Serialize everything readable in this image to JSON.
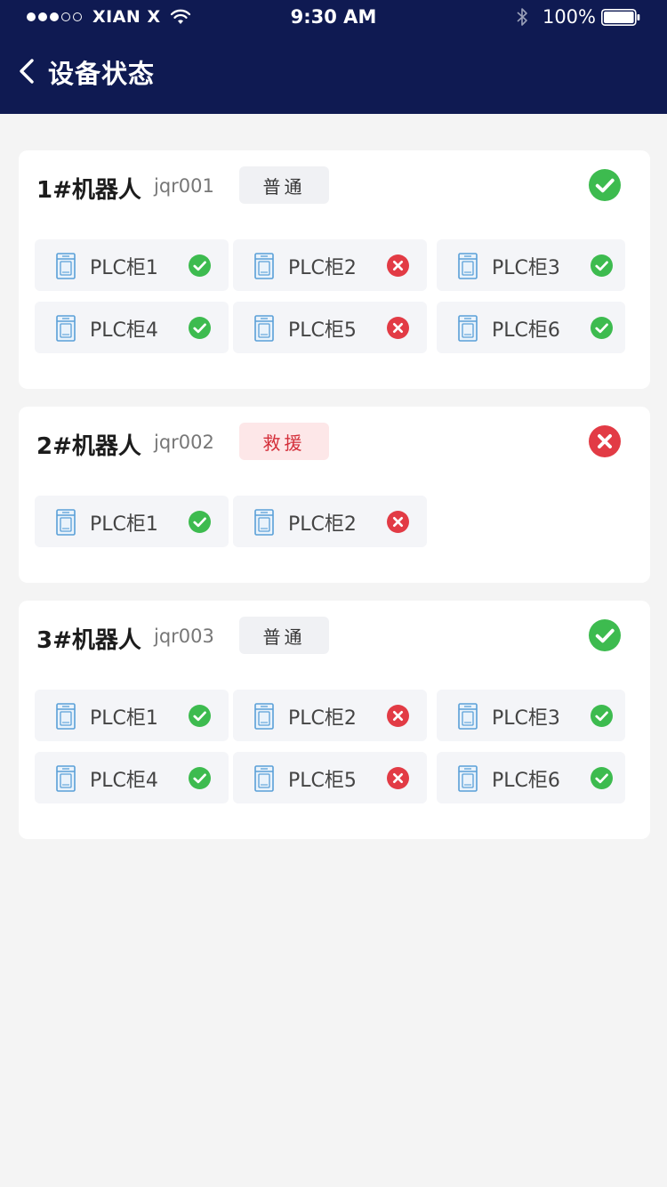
{
  "statusbar": {
    "carrier": "XIAN X",
    "time": "9:30 AM",
    "battery": "100%",
    "signal_icon": "signal-dots-icon",
    "wifi_icon": "wifi-icon",
    "bluetooth_icon": "bluetooth-icon",
    "battery_icon": "battery-icon"
  },
  "nav": {
    "title": "设备状态",
    "back_icon": "chevron-left-icon"
  },
  "colors": {
    "header_bg": "#0f1a52",
    "ok": "#3dbb4f",
    "error": "#e23b45",
    "rescue_tag_bg": "#fde7e8",
    "rescue_tag_text": "#d42f3a"
  },
  "robots": [
    {
      "name": "1#机器人",
      "code": "jqr001",
      "tag": "普通",
      "tag_type": "normal",
      "status": "ok",
      "plcs": [
        {
          "label": "PLC柜1",
          "status": "ok"
        },
        {
          "label": "PLC柜2",
          "status": "error"
        },
        {
          "label": "PLC柜3",
          "status": "ok"
        },
        {
          "label": "PLC柜4",
          "status": "ok"
        },
        {
          "label": "PLC柜5",
          "status": "error"
        },
        {
          "label": "PLC柜6",
          "status": "ok"
        }
      ]
    },
    {
      "name": "2#机器人",
      "code": "jqr002",
      "tag": "救援",
      "tag_type": "rescue",
      "status": "error",
      "plcs": [
        {
          "label": "PLC柜1",
          "status": "ok"
        },
        {
          "label": "PLC柜2",
          "status": "error"
        }
      ]
    },
    {
      "name": "3#机器人",
      "code": "jqr003",
      "tag": "普通",
      "tag_type": "normal",
      "status": "ok",
      "plcs": [
        {
          "label": "PLC柜1",
          "status": "ok"
        },
        {
          "label": "PLC柜2",
          "status": "error"
        },
        {
          "label": "PLC柜3",
          "status": "ok"
        },
        {
          "label": "PLC柜4",
          "status": "ok"
        },
        {
          "label": "PLC柜5",
          "status": "error"
        },
        {
          "label": "PLC柜6",
          "status": "ok"
        }
      ]
    }
  ]
}
